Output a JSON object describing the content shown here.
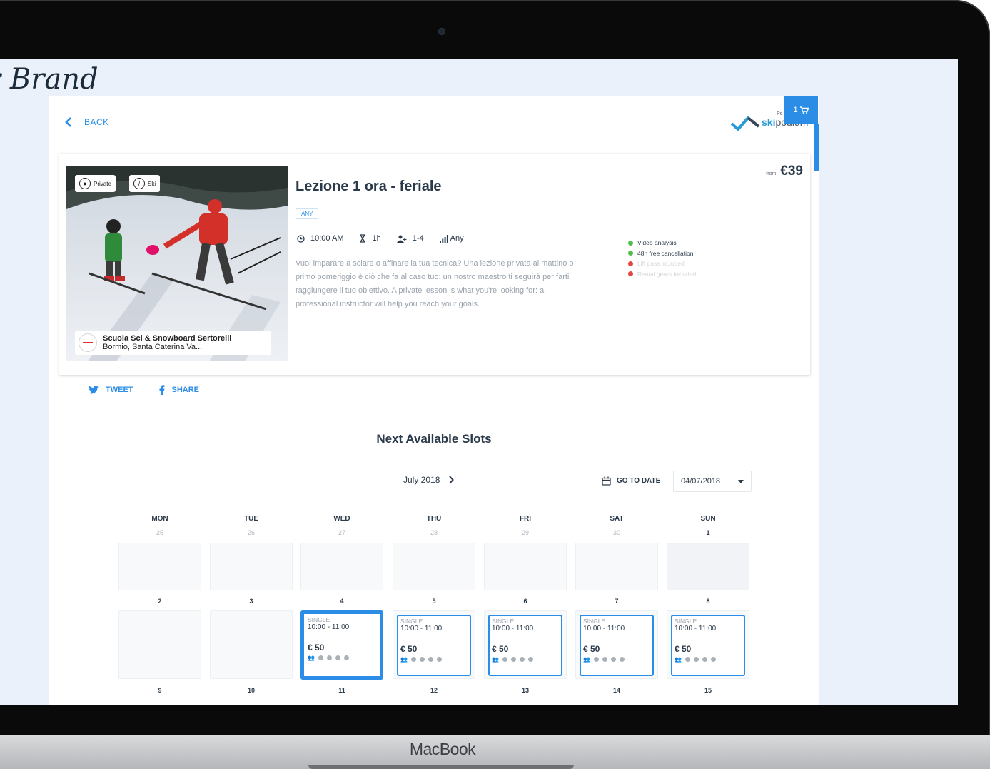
{
  "device": {
    "label": "MacBook"
  },
  "brand": {
    "text": "r Brand"
  },
  "nav": {
    "back_label": "BACK",
    "cart_label": "1"
  },
  "logo": {
    "ski": "ski",
    "podium": "podium",
    "tiny": "Po"
  },
  "lesson": {
    "badges": [
      "Private",
      "Ski"
    ],
    "school_name": "Scuola Sci & Snowboard Sertorelli",
    "school_location": "Bormio,  Santa Caterina Va...",
    "title": "Lezione 1 ora - feriale",
    "tag": "ANY",
    "meta": {
      "time": "10:00 AM",
      "duration": "1h",
      "people": "1-4",
      "level": "Any"
    },
    "description": "Vuoi imparare a sciare o affinare la tua tecnica? Una lezione privata al mattino o primo pomeriggio è ciò che fa al caso tuo: un nostro maestro ti seguirà per farti raggiungere il tuo obiettivo. A private lesson is what you're looking for: a professional instructor will help you reach your goals.",
    "price_from": "from",
    "price": "€39",
    "features": [
      {
        "label": "Video analysis",
        "included": true
      },
      {
        "label": "48h free cancellation",
        "included": true
      },
      {
        "label": "Lift pass included",
        "included": false
      },
      {
        "label": "Rental gears included",
        "included": false
      }
    ]
  },
  "social": {
    "tweet": "TWEET",
    "share": "SHARE"
  },
  "slots": {
    "title": "Next Available Slots",
    "month": "July 2018",
    "goto_label": "GO TO DATE",
    "date_value": "04/07/2018",
    "weekdays": [
      "MON",
      "TUE",
      "WED",
      "THU",
      "FRI",
      "SAT",
      "SUN"
    ],
    "week1": [
      "25",
      "26",
      "27",
      "28",
      "29",
      "30",
      "1"
    ],
    "week2": [
      "2",
      "3",
      "4",
      "5",
      "6",
      "7",
      "8"
    ],
    "week3": [
      "9",
      "10",
      "11",
      "12",
      "13",
      "14",
      "15"
    ],
    "slot": {
      "type": "SINGLE",
      "time": "10:00 - 11:00",
      "price": "€ 50"
    }
  }
}
